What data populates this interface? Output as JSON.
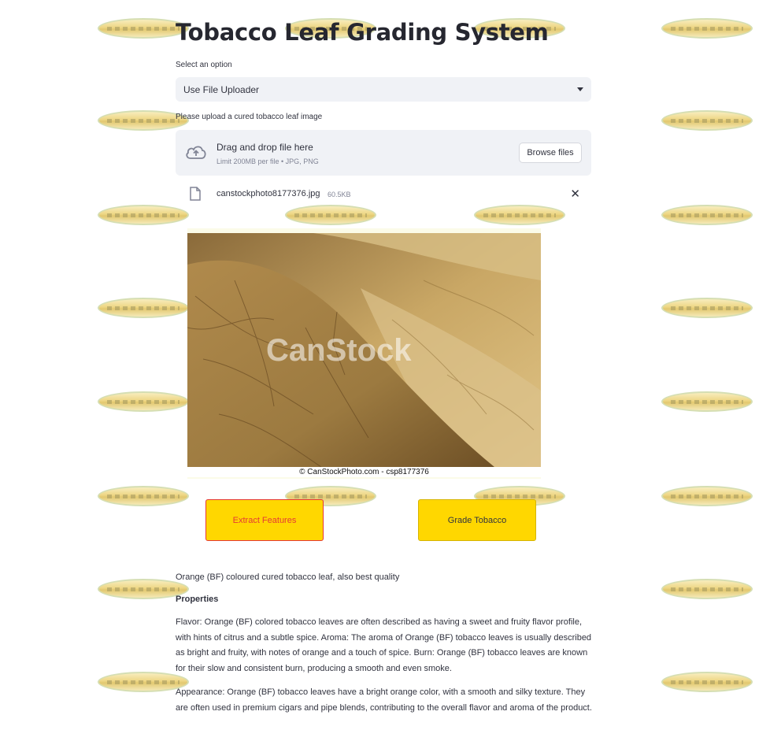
{
  "page": {
    "title": "Tobacco Leaf Grading System"
  },
  "select": {
    "label": "Select an option",
    "value": "Use File Uploader"
  },
  "uploader": {
    "label": "Please upload a cured tobacco leaf image",
    "drag_text": "Drag and drop file here",
    "limit_text": "Limit 200MB per file • JPG, PNG",
    "browse_label": "Browse files"
  },
  "uploaded_file": {
    "name": "canstockphoto8177376.jpg",
    "size": "60.5KB"
  },
  "image": {
    "watermark": "CanStock",
    "caption": "© CanStockPhoto.com - csp8177376"
  },
  "buttons": {
    "extract_label": "Extract Features",
    "grade_label": "Grade Tobacco"
  },
  "result": {
    "summary": "Orange (BF) coloured cured tobacco leaf, also best quality",
    "properties_heading": "Properties",
    "paragraph1": "Flavor: Orange (BF) colored tobacco leaves are often described as having a sweet and fruity flavor profile, with hints of citrus and a subtle spice. Aroma: The aroma of Orange (BF) tobacco leaves is usually described as bright and fruity, with notes of orange and a touch of spice. Burn: Orange (BF) tobacco leaves are known for their slow and consistent burn, producing a smooth and even smoke.",
    "paragraph2": "Appearance: Orange (BF) tobacco leaves have a bright orange color, with a smooth and silky texture. They are often used in premium cigars and pipe blends, contributing to the overall flavor and aroma of the product."
  },
  "colors": {
    "accent_button": "#ffd700",
    "input_bg": "#f0f2f6",
    "text": "#31333f"
  }
}
